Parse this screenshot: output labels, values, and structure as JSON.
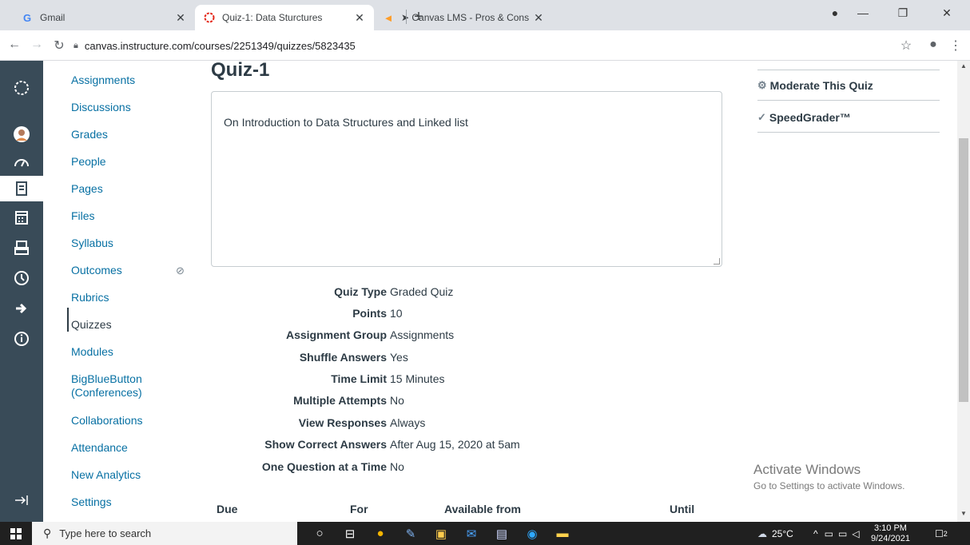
{
  "browser": {
    "tabs": [
      {
        "label": "Gmail",
        "icon": "G"
      },
      {
        "label": "Quiz-1: Data Sturctures",
        "icon": "canvas"
      },
      {
        "label": "➤ Canvas LMS - Pros & Cons",
        "icon": "capterra"
      }
    ],
    "url": "canvas.instructure.com/courses/2251349/quizzes/5823435"
  },
  "course_nav": {
    "items": [
      {
        "label": "Assignments"
      },
      {
        "label": "Discussions"
      },
      {
        "label": "Grades"
      },
      {
        "label": "People"
      },
      {
        "label": "Pages"
      },
      {
        "label": "Files"
      },
      {
        "label": "Syllabus"
      },
      {
        "label": "Outcomes"
      },
      {
        "label": "Rubrics"
      },
      {
        "label": "Quizzes"
      },
      {
        "label": "Modules"
      },
      {
        "label": "BigBlueButton (Conferences)"
      },
      {
        "label": "Collaborations"
      },
      {
        "label": "Attendance"
      },
      {
        "label": "New Analytics"
      },
      {
        "label": "Settings"
      }
    ]
  },
  "quiz": {
    "title": "Quiz-1",
    "description": "On Introduction to Data Structures and Linked list",
    "details": [
      {
        "label": "Quiz Type",
        "value": "Graded Quiz"
      },
      {
        "label": "Points",
        "value": "10"
      },
      {
        "label": "Assignment Group",
        "value": "Assignments"
      },
      {
        "label": "Shuffle Answers",
        "value": "Yes"
      },
      {
        "label": "Time Limit",
        "value": "15 Minutes"
      },
      {
        "label": "Multiple Attempts",
        "value": "No"
      },
      {
        "label": "View Responses",
        "value": "Always"
      },
      {
        "label": "Show Correct Answers",
        "value": "After Aug 15, 2020 at 5am"
      },
      {
        "label": "One Question at a Time",
        "value": "No"
      }
    ],
    "due_table_headers": [
      "Due",
      "For",
      "Available from",
      "Until"
    ]
  },
  "sidebar": {
    "moderate": "Moderate This Quiz",
    "speedgrader": "SpeedGrader™"
  },
  "watermark": {
    "title": "Activate Windows",
    "subtitle": "Go to Settings to activate Windows."
  },
  "taskbar": {
    "search_placeholder": "Type here to search",
    "weather": "25°C",
    "time": "3:10 PM",
    "date": "9/24/2021",
    "notifications": "2"
  },
  "colors": {
    "nav_bg": "#394b58",
    "link": "#0770a3"
  }
}
